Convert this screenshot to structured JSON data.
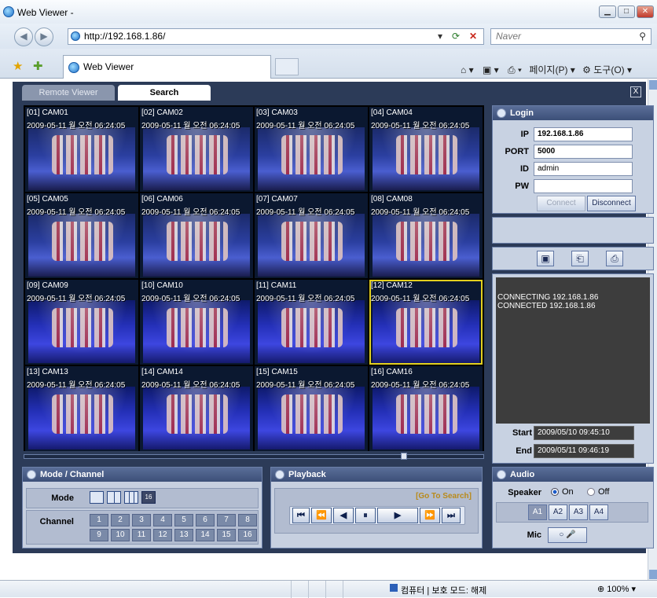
{
  "browser": {
    "window_title": "Web Viewer -",
    "address": "http://192.168.1.86/",
    "search_placeholder": "Naver",
    "tab_title": "Web Viewer",
    "page_menu": "페이지(P)",
    "tools_menu": "도구(O)",
    "status_text": "컴퓨터 | 보호 모드: 해제",
    "zoom": "100%"
  },
  "app": {
    "tabs": [
      {
        "label": "Remote Viewer",
        "active": false
      },
      {
        "label": "Search",
        "active": true
      }
    ],
    "close_glyph": "X"
  },
  "cameras": [
    {
      "label": "[01] CAM01",
      "timestamp": "2009-05-11 월 오전 06:24:05"
    },
    {
      "label": "[02] CAM02",
      "timestamp": "2009-05-11 월 오전 06:24:05"
    },
    {
      "label": "[03] CAM03",
      "timestamp": "2009-05-11 월 오전 06:24:05"
    },
    {
      "label": "[04] CAM04",
      "timestamp": "2009-05-11 월 오전 06:24:05"
    },
    {
      "label": "[05] CAM05",
      "timestamp": "2009-05-11 월 오전 06:24:05"
    },
    {
      "label": "[06] CAM06",
      "timestamp": "2009-05-11 월 오전 06:24:05"
    },
    {
      "label": "[07] CAM07",
      "timestamp": "2009-05-11 월 오전 06:24:05"
    },
    {
      "label": "[08] CAM08",
      "timestamp": "2009-05-11 월 오전 06:24:05"
    },
    {
      "label": "[09] CAM09",
      "timestamp": "2009-05-11 월 오전 06:24:05"
    },
    {
      "label": "[10] CAM10",
      "timestamp": "2009-05-11 월 오전 06:24:05"
    },
    {
      "label": "[11] CAM11",
      "timestamp": "2009-05-11 월 오전 06:24:05"
    },
    {
      "label": "[12] CAM12",
      "timestamp": "2009-05-11 월 오전 06:24:05",
      "selected": true
    },
    {
      "label": "[13] CAM13",
      "timestamp": "2009-05-11 월 오전 06:24:05"
    },
    {
      "label": "[14] CAM14",
      "timestamp": "2009-05-11 월 오전 06:24:05"
    },
    {
      "label": "[15] CAM15",
      "timestamp": "2009-05-11 월 오전 06:24:05"
    },
    {
      "label": "[16] CAM16",
      "timestamp": "2009-05-11 월 오전 06:24:05"
    }
  ],
  "login": {
    "title": "Login",
    "ip_label": "IP",
    "ip": "192.168.1.86",
    "port_label": "PORT",
    "port": "5000",
    "id_label": "ID",
    "id": "admin",
    "pw_label": "PW",
    "pw": "",
    "connect": "Connect",
    "disconnect": "Disconnect"
  },
  "log": {
    "lines": [
      "CONNECTING 192.168.1.86",
      "CONNECTED 192.168.1.86"
    ],
    "start_label": "Start",
    "start": "2009/05/10 09:45:10",
    "end_label": "End",
    "end": "2009/05/11 09:46:19"
  },
  "mode_channel": {
    "title": "Mode / Channel",
    "mode_label": "Mode",
    "active_mode_glyph": "16",
    "channel_label": "Channel",
    "channels": [
      "1",
      "2",
      "3",
      "4",
      "5",
      "6",
      "7",
      "8",
      "9",
      "10",
      "11",
      "12",
      "13",
      "14",
      "15",
      "16"
    ]
  },
  "playback": {
    "title": "Playback",
    "go_to_search": "[Go To Search]",
    "controls": [
      "⏮",
      "⏪",
      "◀",
      "⏸",
      "▶",
      "⏩",
      "⏭"
    ]
  },
  "audio": {
    "title": "Audio",
    "speaker_label": "Speaker",
    "on_label": "On",
    "off_label": "Off",
    "speaker_on": true,
    "channels": [
      "A1",
      "A2",
      "A3",
      "A4"
    ],
    "active_channel": "A1",
    "mic_label": "Mic"
  },
  "colors": {
    "app_bg": "#2c3b58",
    "selection": "#e3d01e",
    "go_to_search": "#b98a1a"
  }
}
